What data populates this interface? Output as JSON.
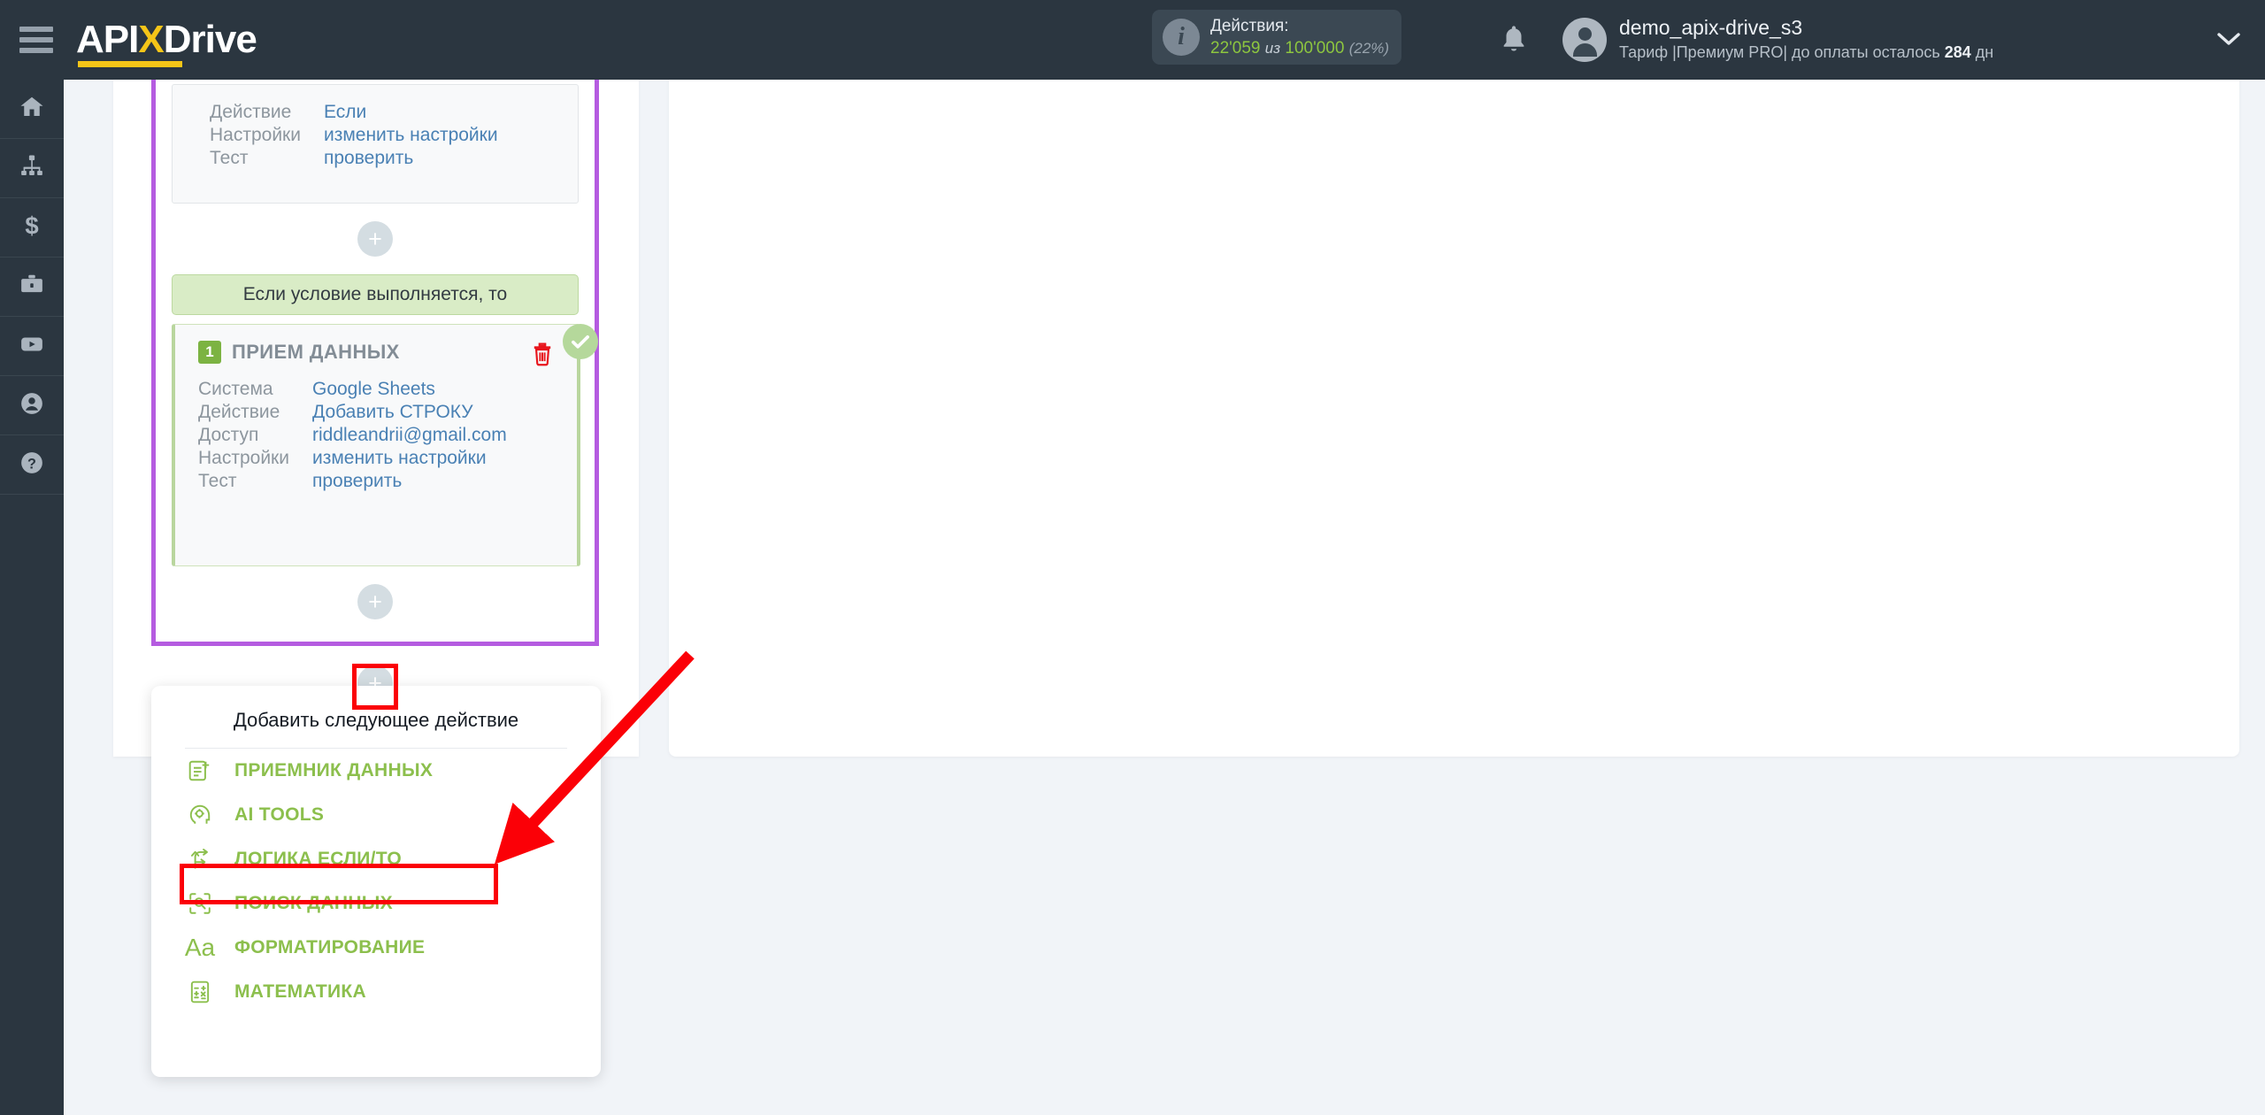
{
  "topbar": {
    "menu_icon": "hamburger-icon",
    "logo": {
      "part1": "API",
      "x": "X",
      "part2": "Drive"
    },
    "usage": {
      "icon": "info-icon",
      "title": "Действия:",
      "used": "22'059",
      "separator": "из",
      "total": "100'000",
      "percent": "(22%)"
    },
    "bell_icon": "notification-bell-icon",
    "avatar_icon": "user-avatar-icon",
    "account_name": "demo_apix-drive_s3",
    "account_plan_prefix": "Тариф |Премиум PRO| до оплаты осталось ",
    "account_plan_days": "284",
    "account_plan_suffix": " дн",
    "chevron_icon": "chevron-down-icon"
  },
  "sidebar": {
    "items": [
      {
        "name": "home",
        "icon": "home-icon"
      },
      {
        "name": "connections",
        "icon": "sitemap-icon"
      },
      {
        "name": "billing",
        "icon": "dollar-icon"
      },
      {
        "name": "services",
        "icon": "briefcase-icon"
      },
      {
        "name": "video",
        "icon": "youtube-icon"
      },
      {
        "name": "profile",
        "icon": "user-circle-icon"
      },
      {
        "name": "help",
        "icon": "question-circle-icon"
      }
    ]
  },
  "flow": {
    "if_card": {
      "rows": [
        {
          "label": "Действие",
          "value": "Если"
        },
        {
          "label": "Настройки",
          "value": "изменить настройки"
        },
        {
          "label": "Тест",
          "value": "проверить"
        }
      ]
    },
    "condition_bar": "Если условие выполняется, то",
    "receiver_card": {
      "number": "1",
      "title": "ПРИЕМ ДАННЫХ",
      "delete_icon": "trash-icon",
      "status_icon": "check-circle-icon",
      "rows": [
        {
          "label": "Система",
          "value": "Google Sheets"
        },
        {
          "label": "Действие",
          "value": "Добавить СТРОКУ"
        },
        {
          "label": "Доступ",
          "value": "riddleandrii@gmail.com"
        },
        {
          "label": "Настройки",
          "value": "изменить настройки"
        },
        {
          "label": "Тест",
          "value": "проверить"
        }
      ]
    },
    "add_button_label": "+"
  },
  "dropdown": {
    "title": "Добавить следующее действие",
    "items": [
      {
        "label": "ПРИЕМНИК ДАННЫХ",
        "icon": "document-add-icon"
      },
      {
        "label": "AI TOOLS",
        "icon": "ai-head-gear-icon"
      },
      {
        "label": "ЛОГИКА ЕСЛИ/ТО",
        "icon": "branch-arrow-icon"
      },
      {
        "label": "ПОИСК ДАННЫХ",
        "icon": "search-scan-icon"
      },
      {
        "label": "ФОРМАТИРОВАНИЕ",
        "icon": "text-format-icon"
      },
      {
        "label": "МАТЕМАТИКА",
        "icon": "calculator-icon"
      }
    ]
  },
  "annotations": {
    "highlight_color": "#fb0007",
    "arrow_icon": "red-arrow-icon",
    "boxes": [
      "add-action-plus-button",
      "logic-if-then-menu-item"
    ]
  },
  "colors": {
    "topbar_bg": "#2b3640",
    "accent_yellow": "#f5c518",
    "green": "#8cbf4d",
    "purple_border": "#b55ce0",
    "link_blue": "#4a81b4",
    "page_bg": "#f1f4f8"
  }
}
